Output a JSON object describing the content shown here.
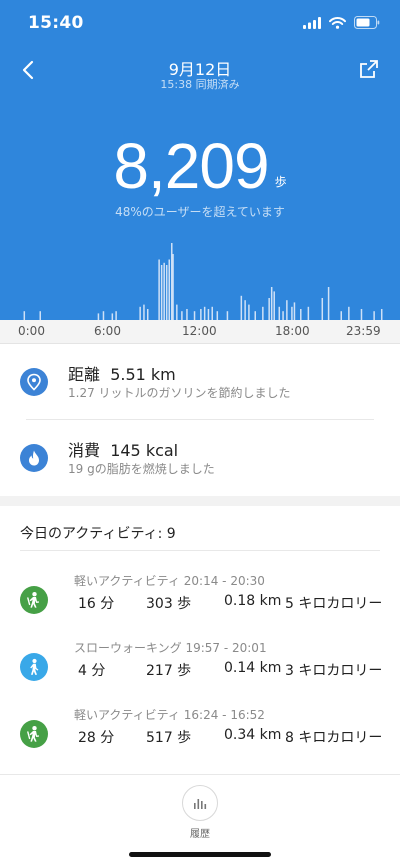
{
  "status_bar": {
    "time": "15:40"
  },
  "header": {
    "date": "9月12日",
    "sync": "15:38 同期済み"
  },
  "summary": {
    "steps": "8,209",
    "steps_unit": "歩",
    "percentile_text": "48%のユーザーを超えています"
  },
  "chart_data": {
    "type": "bar",
    "x_unit": "time of day",
    "xlim": [
      "0:00",
      "23:59"
    ],
    "x_ticks": [
      "0:00",
      "6:00",
      "12:00",
      "18:00",
      "23:59"
    ],
    "grid": false,
    "series": [
      {
        "points": [
          [
            "0:17",
            0.08
          ],
          [
            "1:20",
            0.08
          ],
          [
            "5:10",
            0.06
          ],
          [
            "5:30",
            0.08
          ],
          [
            "6:05",
            0.06
          ],
          [
            "6:20",
            0.08
          ],
          [
            "7:55",
            0.12
          ],
          [
            "8:10",
            0.14
          ],
          [
            "8:25",
            0.1
          ],
          [
            "9:10",
            0.55
          ],
          [
            "9:20",
            0.5
          ],
          [
            "9:30",
            0.52
          ],
          [
            "9:40",
            0.5
          ],
          [
            "9:50",
            0.55
          ],
          [
            "10:00",
            0.7
          ],
          [
            "10:05",
            0.6
          ],
          [
            "10:20",
            0.14
          ],
          [
            "10:40",
            0.08
          ],
          [
            "11:00",
            0.1
          ],
          [
            "11:30",
            0.08
          ],
          [
            "11:55",
            0.1
          ],
          [
            "12:10",
            0.12
          ],
          [
            "12:25",
            0.1
          ],
          [
            "12:40",
            0.12
          ],
          [
            "13:00",
            0.08
          ],
          [
            "13:40",
            0.08
          ],
          [
            "14:35",
            0.22
          ],
          [
            "14:50",
            0.18
          ],
          [
            "15:05",
            0.14
          ],
          [
            "15:30",
            0.08
          ],
          [
            "16:00",
            0.12
          ],
          [
            "16:25",
            0.2
          ],
          [
            "16:35",
            0.3
          ],
          [
            "16:45",
            0.26
          ],
          [
            "17:05",
            0.12
          ],
          [
            "17:20",
            0.08
          ],
          [
            "17:35",
            0.18
          ],
          [
            "17:55",
            0.12
          ],
          [
            "18:05",
            0.16
          ],
          [
            "18:30",
            0.1
          ],
          [
            "19:00",
            0.12
          ],
          [
            "19:55",
            0.2
          ],
          [
            "20:20",
            0.3
          ],
          [
            "21:10",
            0.08
          ],
          [
            "21:40",
            0.12
          ],
          [
            "22:30",
            0.1
          ],
          [
            "23:20",
            0.08
          ],
          [
            "23:50",
            0.1
          ]
        ]
      }
    ]
  },
  "metrics": {
    "distance": {
      "icon": "location-pin-icon",
      "title": "距離",
      "value": "5.51 km",
      "note": "1.27 リットルのガソリンを節約しました"
    },
    "calories": {
      "icon": "flame-icon",
      "title": "消費",
      "value": "145 kcal",
      "note": "19 gの脂肪を燃焼しました"
    }
  },
  "activity": {
    "header": "今日のアクティビティ: 9",
    "items": [
      {
        "icon": "light-activity-icon",
        "color": "#46a046",
        "title": "軽いアクティビティ 20:14 - 20:30",
        "minutes": "16  分",
        "steps": "303 歩",
        "distance": "0.18 km",
        "calories": "5 キロカロリー"
      },
      {
        "icon": "walking-icon",
        "color": "#39a8e8",
        "title": "スローウォーキング 19:57 - 20:01",
        "minutes": "4  分",
        "steps": "217 歩",
        "distance": "0.14 km",
        "calories": "3 キロカロリー"
      },
      {
        "icon": "light-activity-icon",
        "color": "#46a046",
        "title": "軽いアクティビティ 16:24 - 16:52",
        "minutes": "28  分",
        "steps": "517 歩",
        "distance": "0.34 km",
        "calories": "8 キロカロリー"
      }
    ]
  },
  "bottom": {
    "history_label": "履歴",
    "history_icon": "bar-chart-icon"
  },
  "colors": {
    "hero": "#2f86dc",
    "bar": "#cfe1f7",
    "metric_icon": "#3c83d6"
  }
}
